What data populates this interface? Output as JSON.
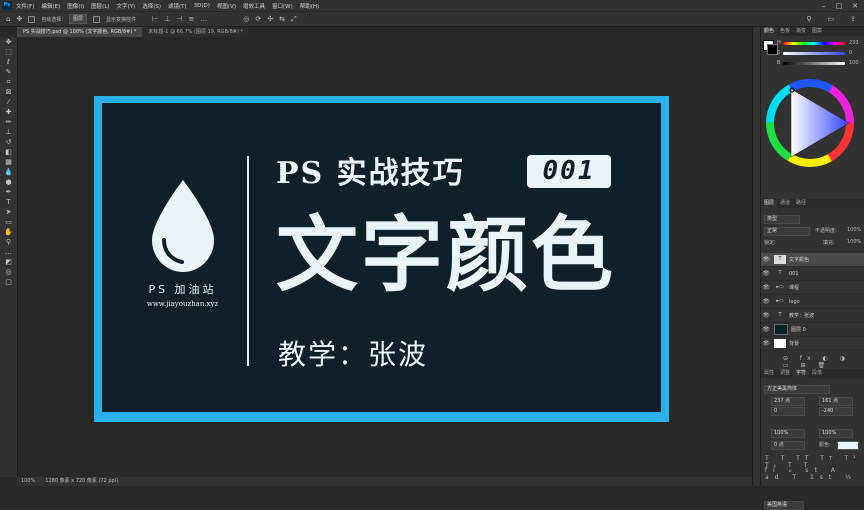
{
  "app": {
    "logo": "Ps"
  },
  "menu": [
    "文件(F)",
    "编辑(E)",
    "图像(I)",
    "图层(L)",
    "文字(Y)",
    "选择(S)",
    "滤镜(T)",
    "3D(D)",
    "视图(V)",
    "增效工具",
    "窗口(W)",
    "帮助(H)"
  ],
  "options": {
    "auto_select_label": "自动选择:",
    "auto_select_value": "图层",
    "show_transform": "显示变换控件"
  },
  "tabs": [
    {
      "label": "PS 实战技巧.psd @ 100% (文字颜色, RGB/8#) *",
      "active": true
    },
    {
      "label": "未标题-1 @ 66.7% (图层 19, RGB/8#) *",
      "active": false
    }
  ],
  "canvas": {
    "logo_text": "PS 加油站",
    "site": "www.jiayouzhan.xyz",
    "title_small": "PS 实战技巧",
    "badge": "001",
    "title_big": "文字颜色",
    "teacher": "教学：张波"
  },
  "status": {
    "zoom": "100%",
    "size": "1280 像素 x 720 像素 (72 ppi)"
  },
  "color_panel": {
    "tabs": [
      "颜色",
      "色板",
      "渐变",
      "图案"
    ],
    "h_label": "H",
    "h_value": "233",
    "s_label": "S",
    "s_value": "0",
    "b_label": "B",
    "b_value": "100"
  },
  "layers_panel": {
    "tabs": [
      "图层",
      "通道",
      "路径"
    ],
    "kind": "类型",
    "blend": "正常",
    "opacity_label": "不透明度:",
    "opacity": "100%",
    "lock_label": "锁定:",
    "fill_label": "填充:",
    "fill": "100%",
    "layers": [
      {
        "name": "文字颜色",
        "type": "T",
        "selected": true
      },
      {
        "name": "001",
        "type": "T",
        "selected": false
      },
      {
        "name": "课程",
        "type": "folder",
        "selected": false
      },
      {
        "name": "logo",
        "type": "folder",
        "selected": false
      },
      {
        "name": "教学：张波",
        "type": "T",
        "selected": false
      },
      {
        "name": "图层 0",
        "type": "dark",
        "selected": false
      },
      {
        "name": "背景",
        "type": "white",
        "selected": false
      }
    ]
  },
  "char_panel": {
    "tabs": [
      "属性",
      "调整",
      "字符",
      "段落"
    ],
    "font": "方正美黑简体",
    "size": "237 点",
    "leading": "161 点",
    "tracking": "0",
    "kerning": "-240",
    "scale_v": "100%",
    "scale_h": "100%",
    "baseline": "0 点",
    "color_label": "颜色:",
    "language": "美国英语"
  },
  "colors": {
    "frame": "#29b2ea",
    "inner": "#0e2028",
    "text": "#e8f4f8"
  }
}
